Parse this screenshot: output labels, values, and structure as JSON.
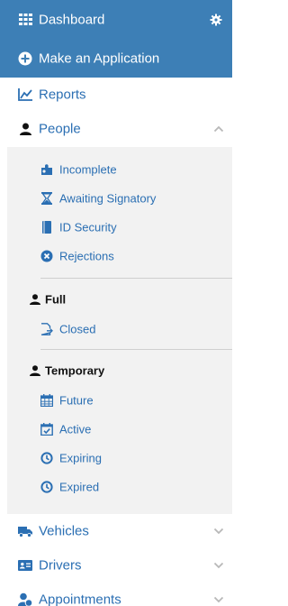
{
  "colors": {
    "header_bg": "#3d7fb6",
    "link": "#2b6fb3",
    "submenu_bg": "#f2f2f2",
    "divider": "#cfcfcf"
  },
  "top": {
    "dashboard_label": "Dashboard",
    "dashboard_icon": "grid-icon",
    "settings_icon": "gear-icon",
    "make_application_label": "Make an Application",
    "make_application_icon": "plus-circle-icon"
  },
  "menu": {
    "reports": {
      "label": "Reports",
      "icon": "line-chart-icon"
    },
    "people": {
      "label": "People",
      "icon": "user-icon",
      "expanded": true
    },
    "vehicles": {
      "label": "Vehicles",
      "icon": "truck-icon",
      "expanded": false
    },
    "drivers": {
      "label": "Drivers",
      "icon": "id-card-icon",
      "expanded": false
    },
    "appointments": {
      "label": "Appointments",
      "icon": "user-clock-icon",
      "expanded": false
    }
  },
  "people_submenu": {
    "incomplete": {
      "label": "Incomplete",
      "icon": "puzzle-icon"
    },
    "awaiting_signatory": {
      "label": "Awaiting Signatory",
      "icon": "hourglass-icon"
    },
    "id_security": {
      "label": "ID Security",
      "icon": "book-icon"
    },
    "rejections": {
      "label": "Rejections",
      "icon": "times-circle-icon"
    },
    "full_heading": "Full",
    "closed": {
      "label": "Closed",
      "icon": "file-export-icon"
    },
    "temporary_heading": "Temporary",
    "future": {
      "label": "Future",
      "icon": "calendar-icon"
    },
    "active": {
      "label": "Active",
      "icon": "calendar-check-icon"
    },
    "expiring": {
      "label": "Expiring",
      "icon": "clock-icon"
    },
    "expired": {
      "label": "Expired",
      "icon": "clock-icon"
    }
  }
}
